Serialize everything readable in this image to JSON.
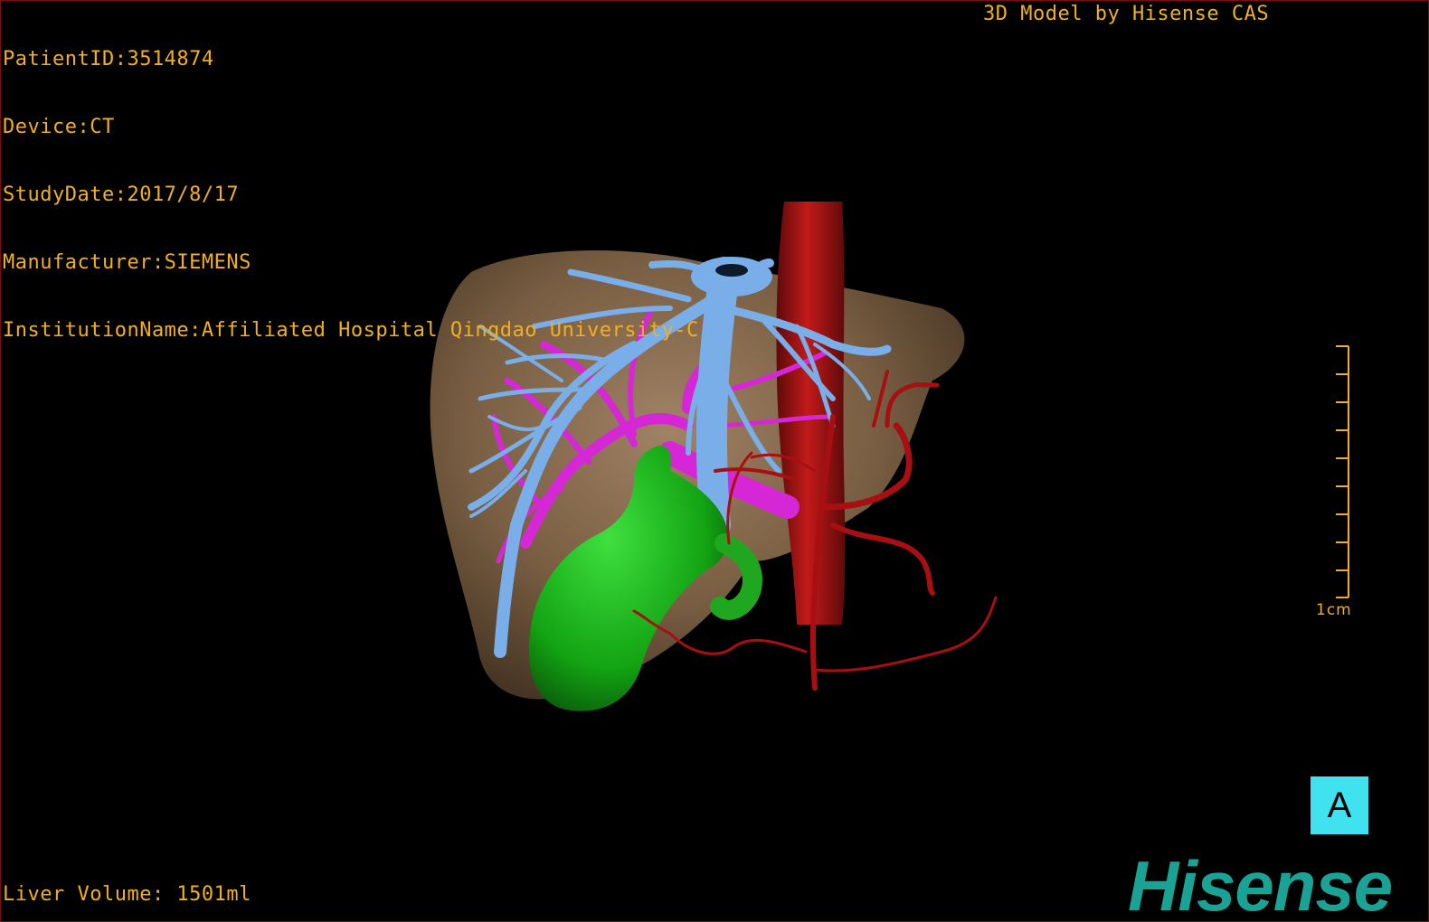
{
  "header": {
    "patient_id": "PatientID:3514874",
    "device": "Device:CT",
    "study_date": "StudyDate:2017/8/17",
    "manufacturer": "Manufacturer:SIEMENS",
    "institution": "InstitutionName:Affiliated Hospital Qingdao University-C"
  },
  "credit": "3D Model by Hisense CAS",
  "footer": {
    "liver_volume": "Liver Volume: 1501ml"
  },
  "scale": {
    "label": "1cm"
  },
  "view_button": {
    "label": "A"
  },
  "brand": {
    "logo_text": "Hisense",
    "logo_color": "#1aa394"
  },
  "colors": {
    "overlay_text": "#f2b01e",
    "liver": "#8a6c4c",
    "hepatic_vein": "#79aee8",
    "portal_vein": "#d627d6",
    "artery": "#a80f12",
    "gallbladder": "#1fa81f",
    "view_button_bg": "#3fe2ee"
  }
}
